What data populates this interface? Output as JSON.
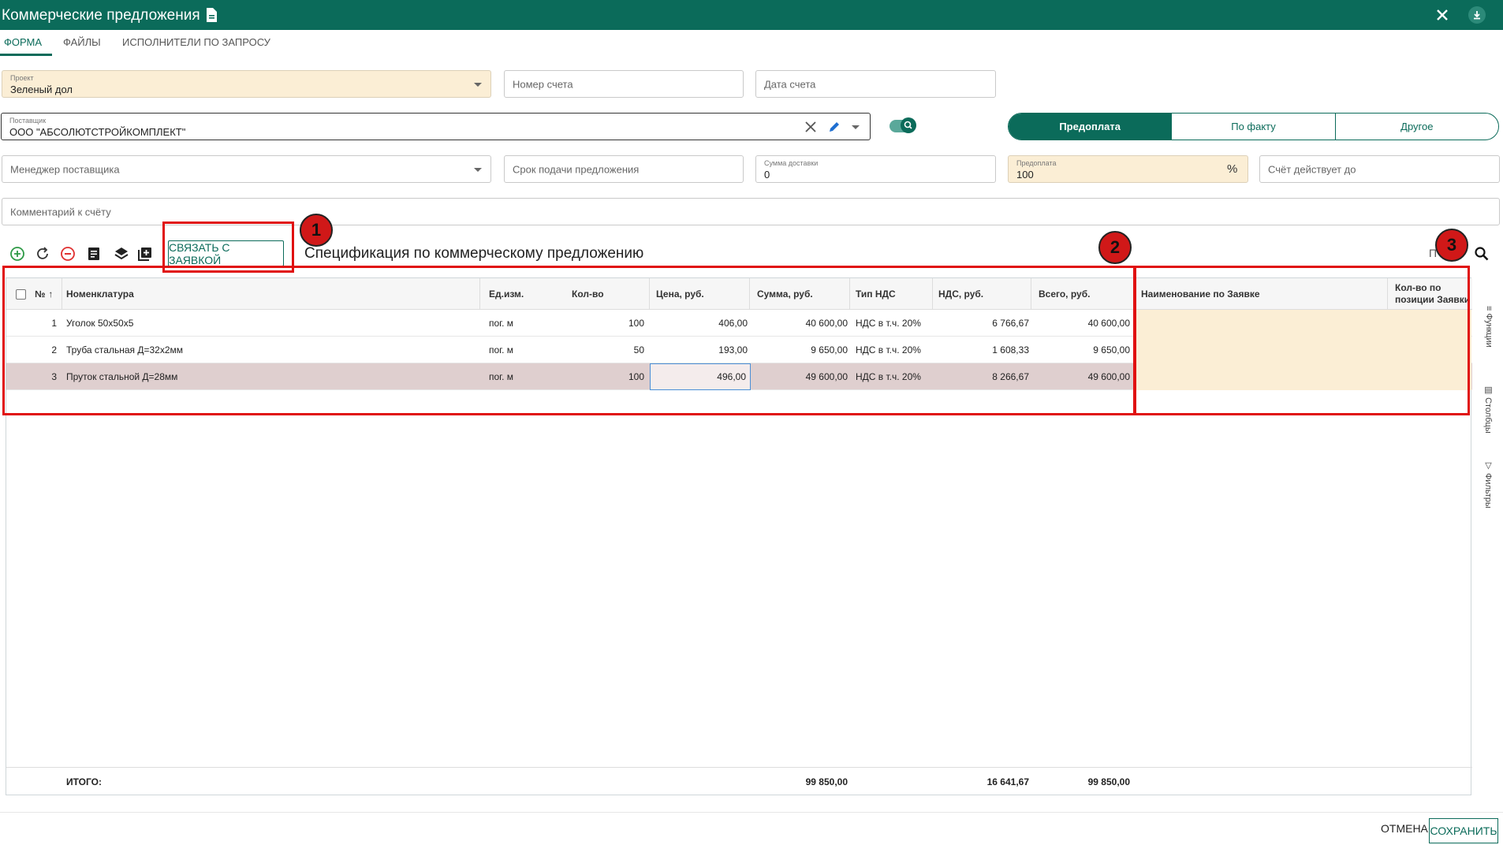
{
  "window": {
    "title": "Коммерческие предложения"
  },
  "tabs": [
    {
      "label": "ФОРМА"
    },
    {
      "label": "ФАЙЛЫ"
    },
    {
      "label": "ИСПОЛНИТЕЛИ ПО ЗАПРОСУ"
    }
  ],
  "form": {
    "project": {
      "label": "Проект",
      "value": "Зеленый дол"
    },
    "invoice_number": {
      "placeholder": "Номер счета"
    },
    "invoice_date": {
      "placeholder": "Дата счета"
    },
    "supplier": {
      "label": "Поставщик",
      "value": "ООО \"АБСОЛЮТСТРОЙКОМПЛЕКТ\""
    },
    "payment_options": [
      "Предоплата",
      "По факту",
      "Другое"
    ],
    "payment_selected": "Предоплата",
    "supplier_manager": {
      "placeholder": "Менеджер поставщика"
    },
    "offer_deadline": {
      "placeholder": "Срок подачи предложения"
    },
    "delivery_sum": {
      "label": "Сумма доставки",
      "value": "0"
    },
    "prepayment": {
      "label": "Предоплата",
      "value": "100",
      "unit": "%"
    },
    "valid_until": {
      "placeholder": "Счёт действует до"
    },
    "comment": {
      "placeholder": "Комментарий к счёту"
    }
  },
  "toolbar": {
    "link_button": "СВЯЗАТЬ С ЗАЯВКОЙ",
    "spec_title": "Спецификация по коммерческому предложению",
    "search_cut": "П"
  },
  "grid": {
    "columns": {
      "num": "№",
      "nomenclature": "Номенклатура",
      "unit": "Ед.изм.",
      "qty": "Кол-во",
      "price": "Цена, руб.",
      "sum": "Сумма, руб.",
      "vat_type": "Тип НДС",
      "vat": "НДС, руб.",
      "total": "Всего, руб.",
      "request_name": "Наименование по Заявке",
      "request_qty": "Кол-во по позиции Заявки"
    },
    "rows": [
      {
        "num": "1",
        "nomenclature": "Уголок 50х50х5",
        "unit": "пог. м",
        "qty": "100",
        "price": "406,00",
        "sum": "40 600,00",
        "vat_type": "НДС в т.ч. 20%",
        "vat": "6 766,67",
        "total": "40 600,00"
      },
      {
        "num": "2",
        "nomenclature": "Труба стальная Д=32х2мм",
        "unit": "пог. м",
        "qty": "50",
        "price": "193,00",
        "sum": "9 650,00",
        "vat_type": "НДС в т.ч. 20%",
        "vat": "1 608,33",
        "total": "9 650,00"
      },
      {
        "num": "3",
        "nomenclature": "Пруток стальной Д=28мм",
        "unit": "пог. м",
        "qty": "100",
        "price": "496,00",
        "sum": "49 600,00",
        "vat_type": "НДС в т.ч. 20%",
        "vat": "8 266,67",
        "total": "49 600,00"
      }
    ],
    "footer": {
      "label": "ИТОГО:",
      "sum": "99 850,00",
      "vat": "16 641,67",
      "total": "99 850,00"
    }
  },
  "side_panel": [
    "Функции",
    "Столбцы",
    "Фильтры"
  ],
  "annotations": [
    "1",
    "2",
    "3"
  ],
  "actions": {
    "cancel": "ОТМЕНА",
    "save": "СОХРАНИТЬ"
  },
  "colors": {
    "primary": "#0b6b5a",
    "highlight": "#fbeed5",
    "annotation": "#e01010"
  }
}
